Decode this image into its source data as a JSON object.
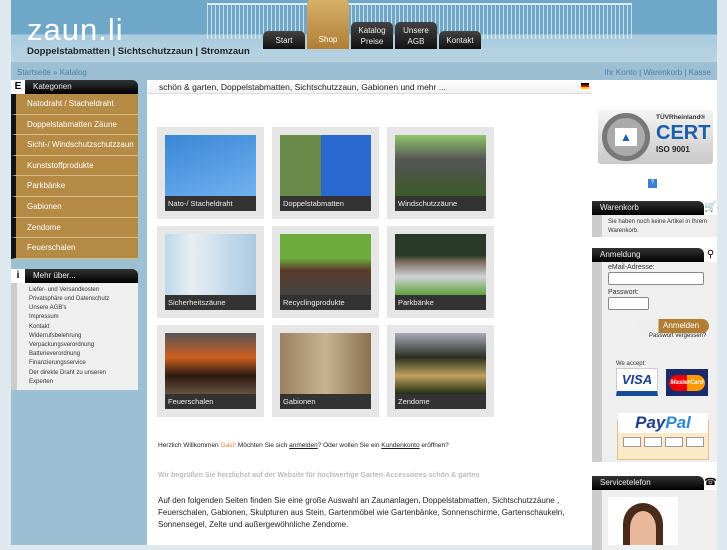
{
  "header": {
    "logo": "zaun.li",
    "tagline": "Doppelstabmatten | Sichtschutzzaun | Stromzaun"
  },
  "nav": [
    {
      "label": "Start"
    },
    {
      "label": "Shop"
    },
    {
      "label": "Katalog Preise"
    },
    {
      "label": "Unsere AGB"
    },
    {
      "label": "Kontakt"
    }
  ],
  "breadcrumb": {
    "home": "Startseite",
    "sep": "»",
    "current": "Katalog"
  },
  "account_links": {
    "account": "Ihr Konto",
    "cart": "Warenkorb",
    "checkout": "Kasse",
    "sep": "|"
  },
  "categories": {
    "title": "Kategorien",
    "icon": "E",
    "items": [
      "Natodraht / Stacheldraht",
      "Doppelstabmatten Zäune",
      "Sicht-/ Windschutzschutzzaun",
      "Kunststoffprodukte",
      "Parkbänke",
      "Gabionen",
      "Zendome",
      "Feuerschalen"
    ]
  },
  "more": {
    "title": "Mehr über...",
    "icon": "i",
    "items": [
      "Liefer- und Versandkosten",
      "Privatsphäre und Datenschutz",
      "Unsere AGB's",
      "Impressum",
      "Kontakt",
      "Widerrufsbelehrung",
      "Verpackungsverordnung",
      "Batterieverordnung",
      "Finanzierungsservice",
      "Der direkte Draht zu unseren",
      "Experten"
    ]
  },
  "main": {
    "heading": "schön & garten, Doppelstabmatten, Sichtschutzzaun, Gabionen und mehr ...",
    "tiles": [
      {
        "label": "Nato-/ Stacheldraht"
      },
      {
        "label": "Doppelstabmatten"
      },
      {
        "label": "Windschutzzäune"
      },
      {
        "label": "Sicherheitszäune"
      },
      {
        "label": "Recyclingprodukte"
      },
      {
        "label": "Parkbänke"
      },
      {
        "label": "Feuerschalen"
      },
      {
        "label": "Gabionen"
      },
      {
        "label": "Zendome"
      }
    ],
    "welcome": {
      "a": "Herzlich Willkommen ",
      "guest": "Gast!",
      "b": " Möchten Sie sich ",
      "login": "anmelden",
      "c": "? Oder wollen Sie ein ",
      "account": "Kundenkonto",
      "d": " eröffnen?"
    },
    "intro": "Wir begrüßen Sie herzlichst auf der Website für hochwertige Garten-Accessoires schön & garten",
    "body": "Auf den folgenden Seiten finden Sie eine große Auswahl an Zaunanlagen, Doppelstabmatten, Sichtschutzzäune , Feuerschalen, Gabionen, Skulpturen aus Stein, Gartenmöbel wie Gartenbänke, Sonnenschirme, Gartenschaukeln, Sonnensegel, Zelte und außergewöhnliche Zendome."
  },
  "right": {
    "tuv": {
      "brand": "TÜVRheinland®",
      "cert": "CERT",
      "iso": "ISO 9001"
    },
    "help": "?",
    "cart": {
      "title": "Warenkorb",
      "text": "Sie haben noch keine Artikel in Ihrem Warenkorb."
    },
    "login": {
      "title": "Anmeldung",
      "email_label": "eMail-Adresse:",
      "email_value": "",
      "password_label": "Passwort:",
      "password_value": "",
      "button": "Anmelden",
      "forgot": "Passwort vergessen?"
    },
    "accept": "We accept:",
    "visa": "VISA",
    "mastercard": "MasterCard",
    "paypal_a": "Pay",
    "paypal_b": "Pal",
    "service": {
      "title": "Servicetelefon"
    }
  }
}
